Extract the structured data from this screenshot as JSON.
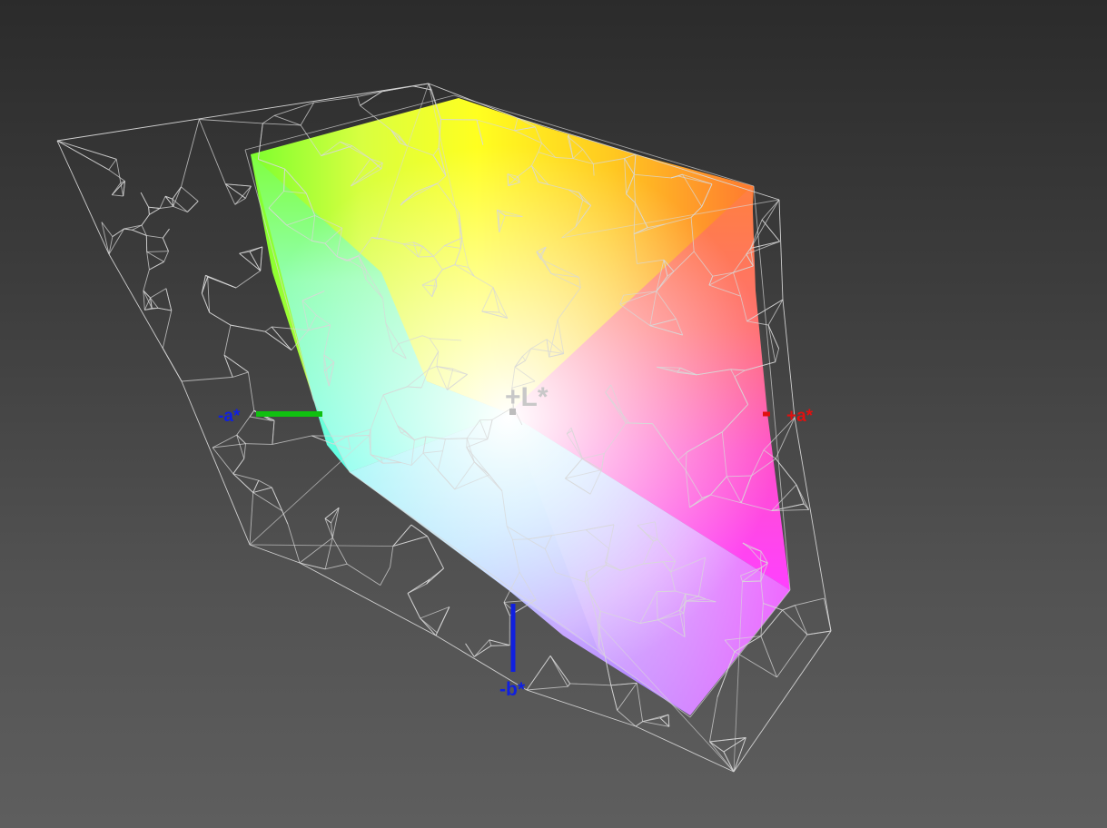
{
  "viewer": {
    "axes": {
      "l_plus": "+L*",
      "a_plus": "+a*",
      "a_minus": "-a*",
      "b_minus": "-b*"
    },
    "colors": {
      "background_top": "#2b2b2b",
      "background_bottom": "#5e5e5e",
      "wireframe": "#d8d8d8",
      "axis_a_plus": "#e01010",
      "axis_a_minus": "#10c010",
      "axis_b_minus": "#1020e0",
      "axis_l_plus": "#c8c8c8"
    }
  }
}
